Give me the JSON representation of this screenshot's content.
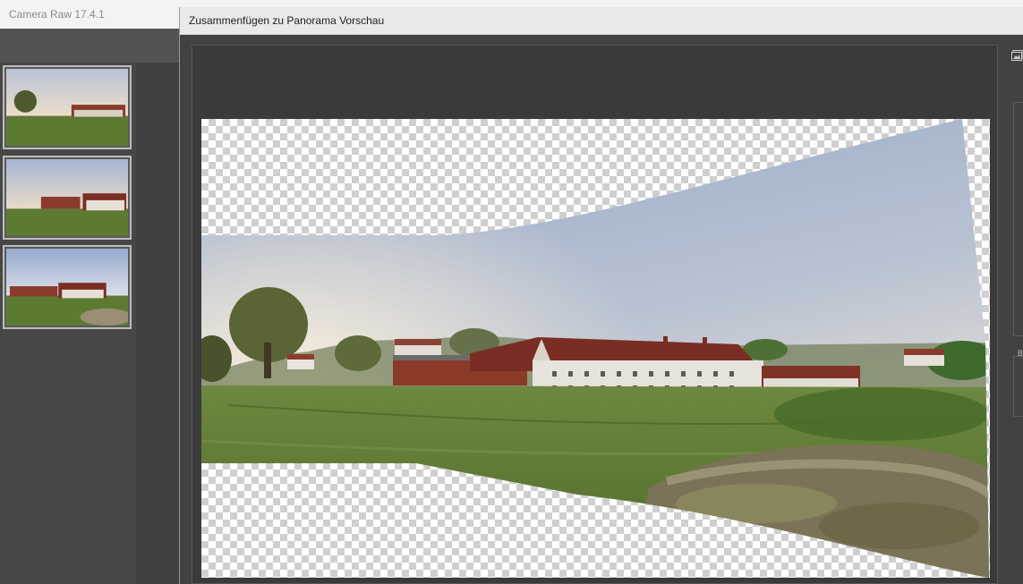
{
  "app": {
    "title": "Camera Raw 17.4.1"
  },
  "filmstrip": {
    "thumbnails": [
      {
        "name": "image-1",
        "selected": true
      },
      {
        "name": "image-2",
        "selected": true
      },
      {
        "name": "image-3",
        "selected": true
      }
    ]
  },
  "dialog": {
    "title": "Zusammenfügen zu Panorama Vorschau"
  },
  "right_panel": {
    "icon": "image-icon",
    "box_label": "B"
  },
  "colors": {
    "sky_top": "#9aabc9",
    "sky_haze": "#efe4d2",
    "grass": "#5f7a35",
    "roof": "#7a2e23",
    "wall": "#e6e3dc"
  }
}
